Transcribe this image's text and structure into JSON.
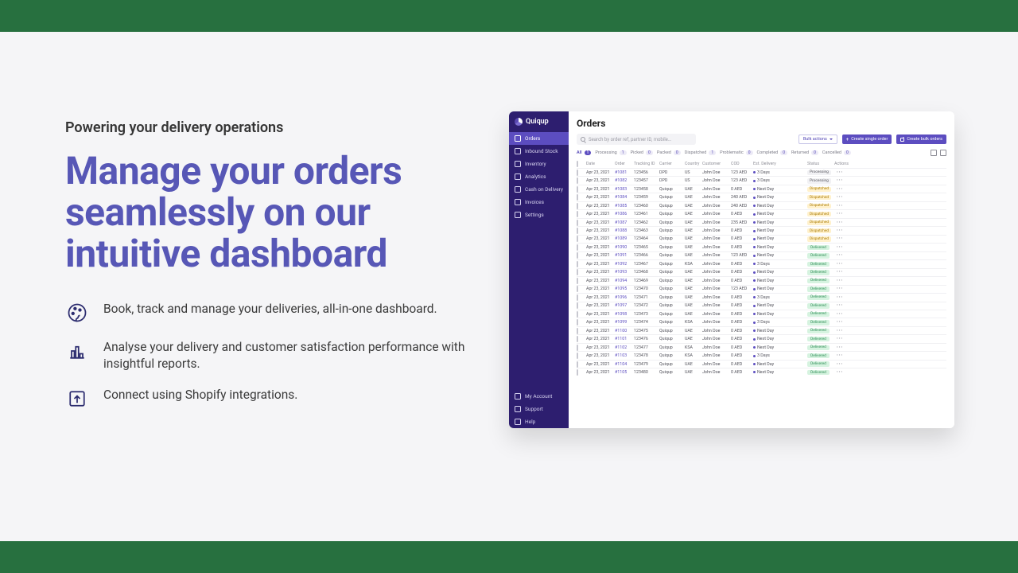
{
  "marketing": {
    "subhead": "Powering your delivery operations",
    "headline": "Manage your orders seamlessly on our intuitive dashboard",
    "features": [
      "Book, track and manage your deliveries, all-in-one dashboard.",
      "Analyse your delivery and customer satisfaction performance with insightful reports.",
      "Connect using Shopify integrations."
    ]
  },
  "dashboard": {
    "brand": "Quiqup",
    "nav": {
      "top": [
        "Orders",
        "Inbound Stock",
        "Inventory",
        "Analytics",
        "Cash on Delivery",
        "Invoices",
        "Settings"
      ],
      "bottom": [
        "My Account",
        "Support",
        "Help"
      ]
    },
    "title": "Orders",
    "search_placeholder": "Search by order ref, partner ID, mobile…",
    "buttons": {
      "bulk": "Bulk actions",
      "single": "Create single order",
      "bulkcreate": "Create bulk orders"
    },
    "tabs": [
      {
        "label": "All",
        "count": "1",
        "active": true
      },
      {
        "label": "Processing",
        "count": "1"
      },
      {
        "label": "Picked",
        "count": "0"
      },
      {
        "label": "Packed",
        "count": "0"
      },
      {
        "label": "Dispatched",
        "count": "1"
      },
      {
        "label": "Problematic",
        "count": "0"
      },
      {
        "label": "Completed",
        "count": "0"
      },
      {
        "label": "Returned",
        "count": "0"
      },
      {
        "label": "Cancelled",
        "count": "0"
      }
    ],
    "columns": [
      "",
      "Date",
      "Order",
      "Tracking ID",
      "Carrier",
      "Country",
      "Customer",
      "COD",
      "Est. Delivery",
      "",
      "Status",
      "Actions"
    ],
    "rows": [
      {
        "date": "Apr 23, 2021",
        "order": "#1081",
        "tracking": "123456",
        "carrier": "DPD",
        "country": "US",
        "customer": "John Doe",
        "cod": "123 AED",
        "delivery": "3 Days",
        "status": "Processing",
        "style": "p-proc"
      },
      {
        "date": "Apr 23, 2021",
        "order": "#1082",
        "tracking": "123457",
        "carrier": "DPD",
        "country": "US",
        "customer": "John Doe",
        "cod": "123 AED",
        "delivery": "3 Days",
        "status": "Processing",
        "style": "p-proc"
      },
      {
        "date": "Apr 23, 2021",
        "order": "#1083",
        "tracking": "123458",
        "carrier": "Quiqup",
        "country": "UAE",
        "customer": "John Doe",
        "cod": "0 AED",
        "delivery": "Next Day",
        "status": "Dispatched",
        "style": "p-disp"
      },
      {
        "date": "Apr 23, 2021",
        "order": "#1084",
        "tracking": "123459",
        "carrier": "Quiqup",
        "country": "UAE",
        "customer": "John Doe",
        "cod": "240 AED",
        "delivery": "Next Day",
        "status": "Dispatched",
        "style": "p-disp"
      },
      {
        "date": "Apr 23, 2021",
        "order": "#1085",
        "tracking": "123460",
        "carrier": "Quiqup",
        "country": "UAE",
        "customer": "John Doe",
        "cod": "240 AED",
        "delivery": "Next Day",
        "status": "Dispatched",
        "style": "p-disp"
      },
      {
        "date": "Apr 23, 2021",
        "order": "#1086",
        "tracking": "123461",
        "carrier": "Quiqup",
        "country": "UAE",
        "customer": "John Doe",
        "cod": "0 AED",
        "delivery": "Next Day",
        "status": "Dispatched",
        "style": "p-disp"
      },
      {
        "date": "Apr 23, 2021",
        "order": "#1087",
        "tracking": "123462",
        "carrier": "Quiqup",
        "country": "UAE",
        "customer": "John Doe",
        "cod": "235 AED",
        "delivery": "Next Day",
        "status": "Dispatched",
        "style": "p-disp"
      },
      {
        "date": "Apr 23, 2021",
        "order": "#1088",
        "tracking": "123463",
        "carrier": "Quiqup",
        "country": "UAE",
        "customer": "John Doe",
        "cod": "0 AED",
        "delivery": "Next Day",
        "status": "Dispatched",
        "style": "p-disp"
      },
      {
        "date": "Apr 23, 2021",
        "order": "#1089",
        "tracking": "123464",
        "carrier": "Quiqup",
        "country": "UAE",
        "customer": "John Doe",
        "cod": "0 AED",
        "delivery": "Next Day",
        "status": "Dispatched",
        "style": "p-disp"
      },
      {
        "date": "Apr 23, 2021",
        "order": "#1090",
        "tracking": "123465",
        "carrier": "Quiqup",
        "country": "UAE",
        "customer": "John Doe",
        "cod": "0 AED",
        "delivery": "Next Day",
        "status": "Delivered",
        "style": "p-deliv"
      },
      {
        "date": "Apr 23, 2021",
        "order": "#1091",
        "tracking": "123466",
        "carrier": "Quiqup",
        "country": "UAE",
        "customer": "John Doe",
        "cod": "123 AED",
        "delivery": "Next Day",
        "status": "Delivered",
        "style": "p-deliv"
      },
      {
        "date": "Apr 23, 2021",
        "order": "#1092",
        "tracking": "123467",
        "carrier": "Quiqup",
        "country": "KSA",
        "customer": "John Doe",
        "cod": "0 AED",
        "delivery": "3 Days",
        "status": "Delivered",
        "style": "p-deliv"
      },
      {
        "date": "Apr 23, 2021",
        "order": "#1093",
        "tracking": "123468",
        "carrier": "Quiqup",
        "country": "UAE",
        "customer": "John Doe",
        "cod": "0 AED",
        "delivery": "Next Day",
        "status": "Delivered",
        "style": "p-deliv"
      },
      {
        "date": "Apr 23, 2021",
        "order": "#1094",
        "tracking": "123469",
        "carrier": "Quiqup",
        "country": "UAE",
        "customer": "John Doe",
        "cod": "0 AED",
        "delivery": "Next Day",
        "status": "Delivered",
        "style": "p-deliv"
      },
      {
        "date": "Apr 23, 2021",
        "order": "#1095",
        "tracking": "123470",
        "carrier": "Quiqup",
        "country": "UAE",
        "customer": "John Doe",
        "cod": "123 AED",
        "delivery": "Next Day",
        "status": "Delivered",
        "style": "p-deliv"
      },
      {
        "date": "Apr 23, 2021",
        "order": "#1096",
        "tracking": "123471",
        "carrier": "Quiqup",
        "country": "UAE",
        "customer": "John Doe",
        "cod": "0 AED",
        "delivery": "3 Days",
        "status": "Delivered",
        "style": "p-deliv"
      },
      {
        "date": "Apr 23, 2021",
        "order": "#1097",
        "tracking": "123472",
        "carrier": "Quiqup",
        "country": "UAE",
        "customer": "John Doe",
        "cod": "0 AED",
        "delivery": "Next Day",
        "status": "Delivered",
        "style": "p-deliv"
      },
      {
        "date": "Apr 23, 2021",
        "order": "#1098",
        "tracking": "123473",
        "carrier": "Quiqup",
        "country": "UAE",
        "customer": "John Doe",
        "cod": "0 AED",
        "delivery": "Next Day",
        "status": "Delivered",
        "style": "p-deliv"
      },
      {
        "date": "Apr 23, 2021",
        "order": "#1099",
        "tracking": "123474",
        "carrier": "Quiqup",
        "country": "KSA",
        "customer": "John Doe",
        "cod": "0 AED",
        "delivery": "3 Days",
        "status": "Delivered",
        "style": "p-deliv"
      },
      {
        "date": "Apr 23, 2021",
        "order": "#1100",
        "tracking": "123475",
        "carrier": "Quiqup",
        "country": "UAE",
        "customer": "John Doe",
        "cod": "0 AED",
        "delivery": "Next Day",
        "status": "Delivered",
        "style": "p-deliv"
      },
      {
        "date": "Apr 23, 2021",
        "order": "#1101",
        "tracking": "123476",
        "carrier": "Quiqup",
        "country": "UAE",
        "customer": "John Doe",
        "cod": "0 AED",
        "delivery": "Next Day",
        "status": "Delivered",
        "style": "p-deliv"
      },
      {
        "date": "Apr 23, 2021",
        "order": "#1102",
        "tracking": "123477",
        "carrier": "Quiqup",
        "country": "KSA",
        "customer": "John Doe",
        "cod": "0 AED",
        "delivery": "Next Day",
        "status": "Delivered",
        "style": "p-deliv"
      },
      {
        "date": "Apr 23, 2021",
        "order": "#1103",
        "tracking": "123478",
        "carrier": "Quiqup",
        "country": "KSA",
        "customer": "John Doe",
        "cod": "0 AED",
        "delivery": "3 Days",
        "status": "Delivered",
        "style": "p-deliv"
      },
      {
        "date": "Apr 23, 2021",
        "order": "#1104",
        "tracking": "123479",
        "carrier": "Quiqup",
        "country": "UAE",
        "customer": "John Doe",
        "cod": "0 AED",
        "delivery": "Next Day",
        "status": "Delivered",
        "style": "p-deliv"
      },
      {
        "date": "Apr 23, 2021",
        "order": "#1105",
        "tracking": "123480",
        "carrier": "Quiqup",
        "country": "UAE",
        "customer": "John Doe",
        "cod": "0 AED",
        "delivery": "Next Day",
        "status": "Delivered",
        "style": "p-deliv"
      }
    ]
  }
}
